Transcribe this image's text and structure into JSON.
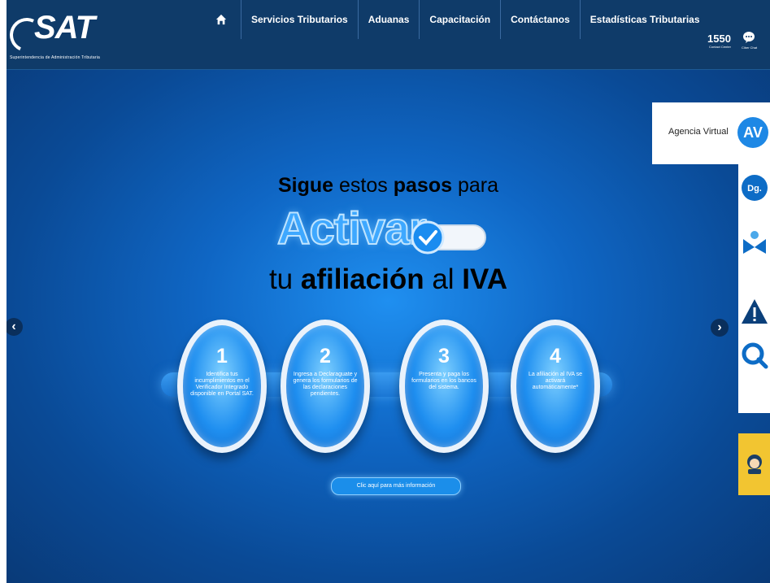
{
  "header": {
    "logo_text": "SAT",
    "logo_subtitle": "Superintendencia de Administración Tributaria",
    "nav": [
      {
        "label": "Servicios Tributarios"
      },
      {
        "label": "Aduanas"
      },
      {
        "label": "Capacitación"
      },
      {
        "label": "Contáctanos"
      },
      {
        "label": "Estadísticas Tributarias"
      }
    ],
    "phone": "1550",
    "phone_sub": "Contact Center",
    "chat_label": "Ciber Chat"
  },
  "hero": {
    "line1_a": "Sigue",
    "line1_b": " estos ",
    "line1_c": "pasos",
    "line1_d": " para",
    "line2": "Activar",
    "line3_a": "tu ",
    "line3_b": "afiliación",
    "line3_c": " al ",
    "line3_d": "IVA",
    "steps": [
      {
        "num": "1",
        "text": "Identifica tus incumplimientos en el Verificador Integrado disponible en Portal SAT."
      },
      {
        "num": "2",
        "text": "Ingresa a Declaraguate y genera los formularios de las declaraciones pendientes."
      },
      {
        "num": "3",
        "text": "Presenta y paga los formularios en los bancos del sistema."
      },
      {
        "num": "4",
        "text": "La afiliación al IVA se activará automáticamente*"
      }
    ],
    "info_button": "Clic aquí para más información"
  },
  "side": {
    "agencia_label": "Agencia Virtual",
    "av_text": "AV",
    "dg_text": "Dg."
  },
  "colors": {
    "header_bg": "#0f3b69",
    "hero_bg": "#0a4a96",
    "accent": "#1e88e5",
    "support_bg": "#f2c531"
  }
}
